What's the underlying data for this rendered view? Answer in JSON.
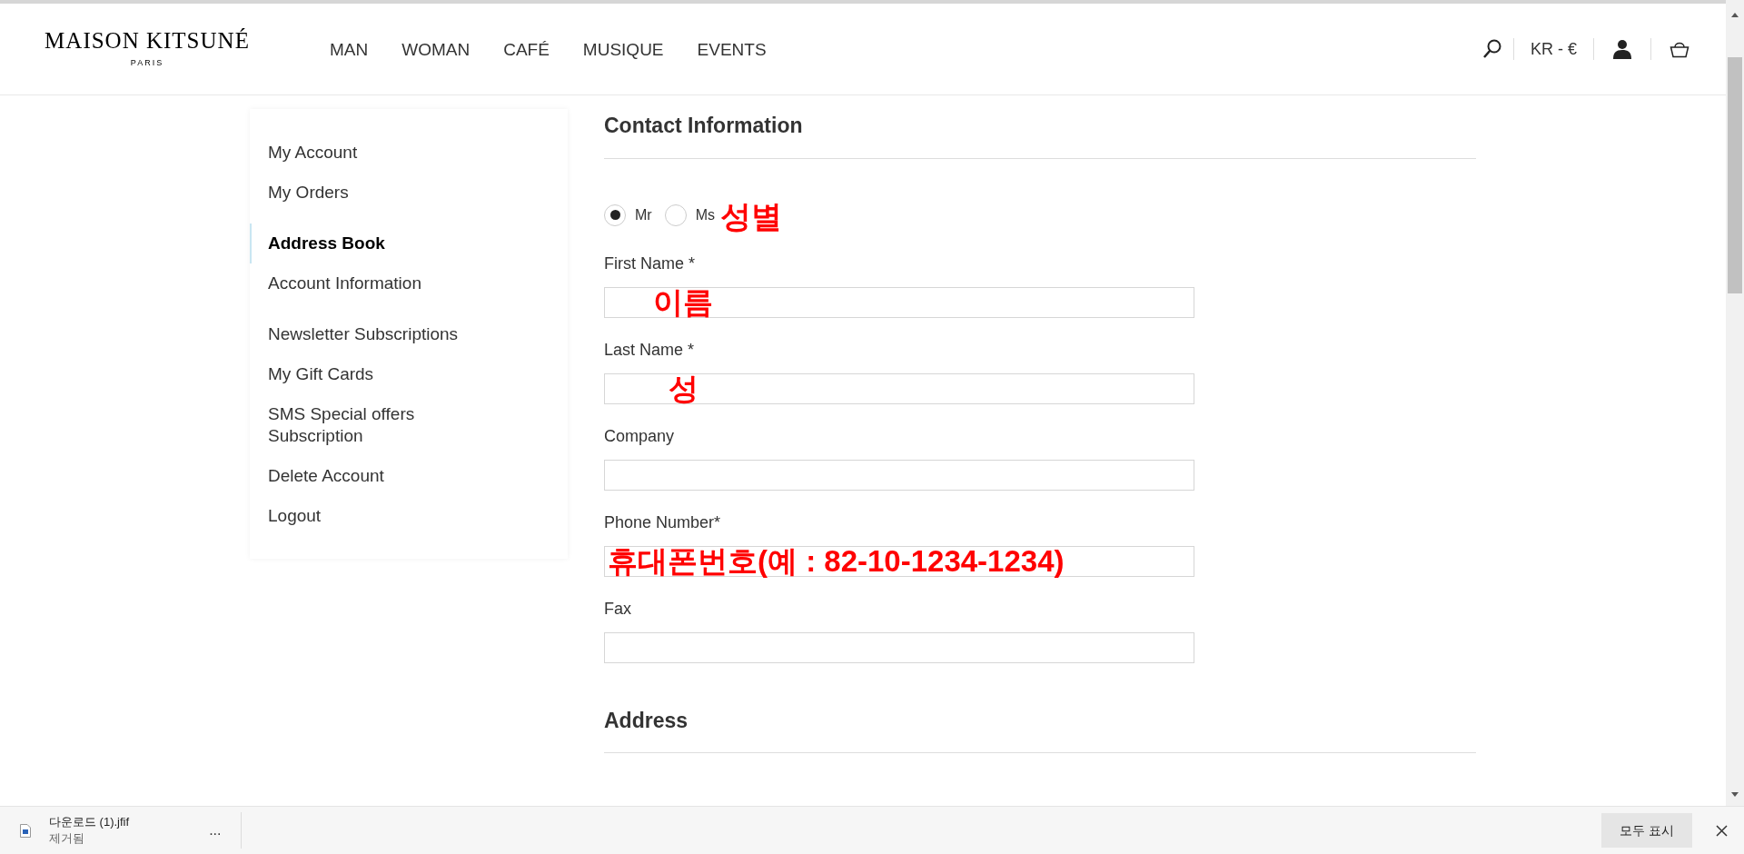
{
  "header": {
    "logo": "MAISON KITSUNÉ",
    "logo_sub": "PARIS",
    "nav": [
      "MAN",
      "WOMAN",
      "CAFÉ",
      "MUSIQUE",
      "EVENTS"
    ],
    "currency": "KR - €"
  },
  "sidebar": {
    "groups": [
      [
        {
          "label": "My Account",
          "selected": false
        },
        {
          "label": "My Orders",
          "selected": false
        }
      ],
      [
        {
          "label": "Address Book",
          "selected": true
        },
        {
          "label": "Account Information",
          "selected": false
        }
      ],
      [
        {
          "label": "Newsletter Subscriptions",
          "selected": false
        },
        {
          "label": "My Gift Cards",
          "selected": false
        },
        {
          "label": "SMS Special offers Subscription",
          "selected": false
        },
        {
          "label": "Delete Account",
          "selected": false
        },
        {
          "label": "Logout",
          "selected": false
        }
      ]
    ]
  },
  "contact": {
    "title": "Contact Information",
    "gender": {
      "options": [
        {
          "label": "Mr",
          "selected": true
        },
        {
          "label": "Ms",
          "selected": false
        }
      ],
      "annotation": "성별"
    },
    "fields": [
      {
        "label": "First Name *",
        "annotation": "이름"
      },
      {
        "label": "Last Name *",
        "annotation": "성"
      },
      {
        "label": "Company"
      },
      {
        "label": "Phone Number*",
        "annotation": "휴대폰번호(예 : 82-10-1234-1234)"
      },
      {
        "label": "Fax"
      }
    ]
  },
  "address": {
    "title": "Address"
  },
  "download_bar": {
    "file": "다운로드 (1).jfif",
    "status": "제거됨",
    "more": "...",
    "show_all": "모두 표시"
  }
}
